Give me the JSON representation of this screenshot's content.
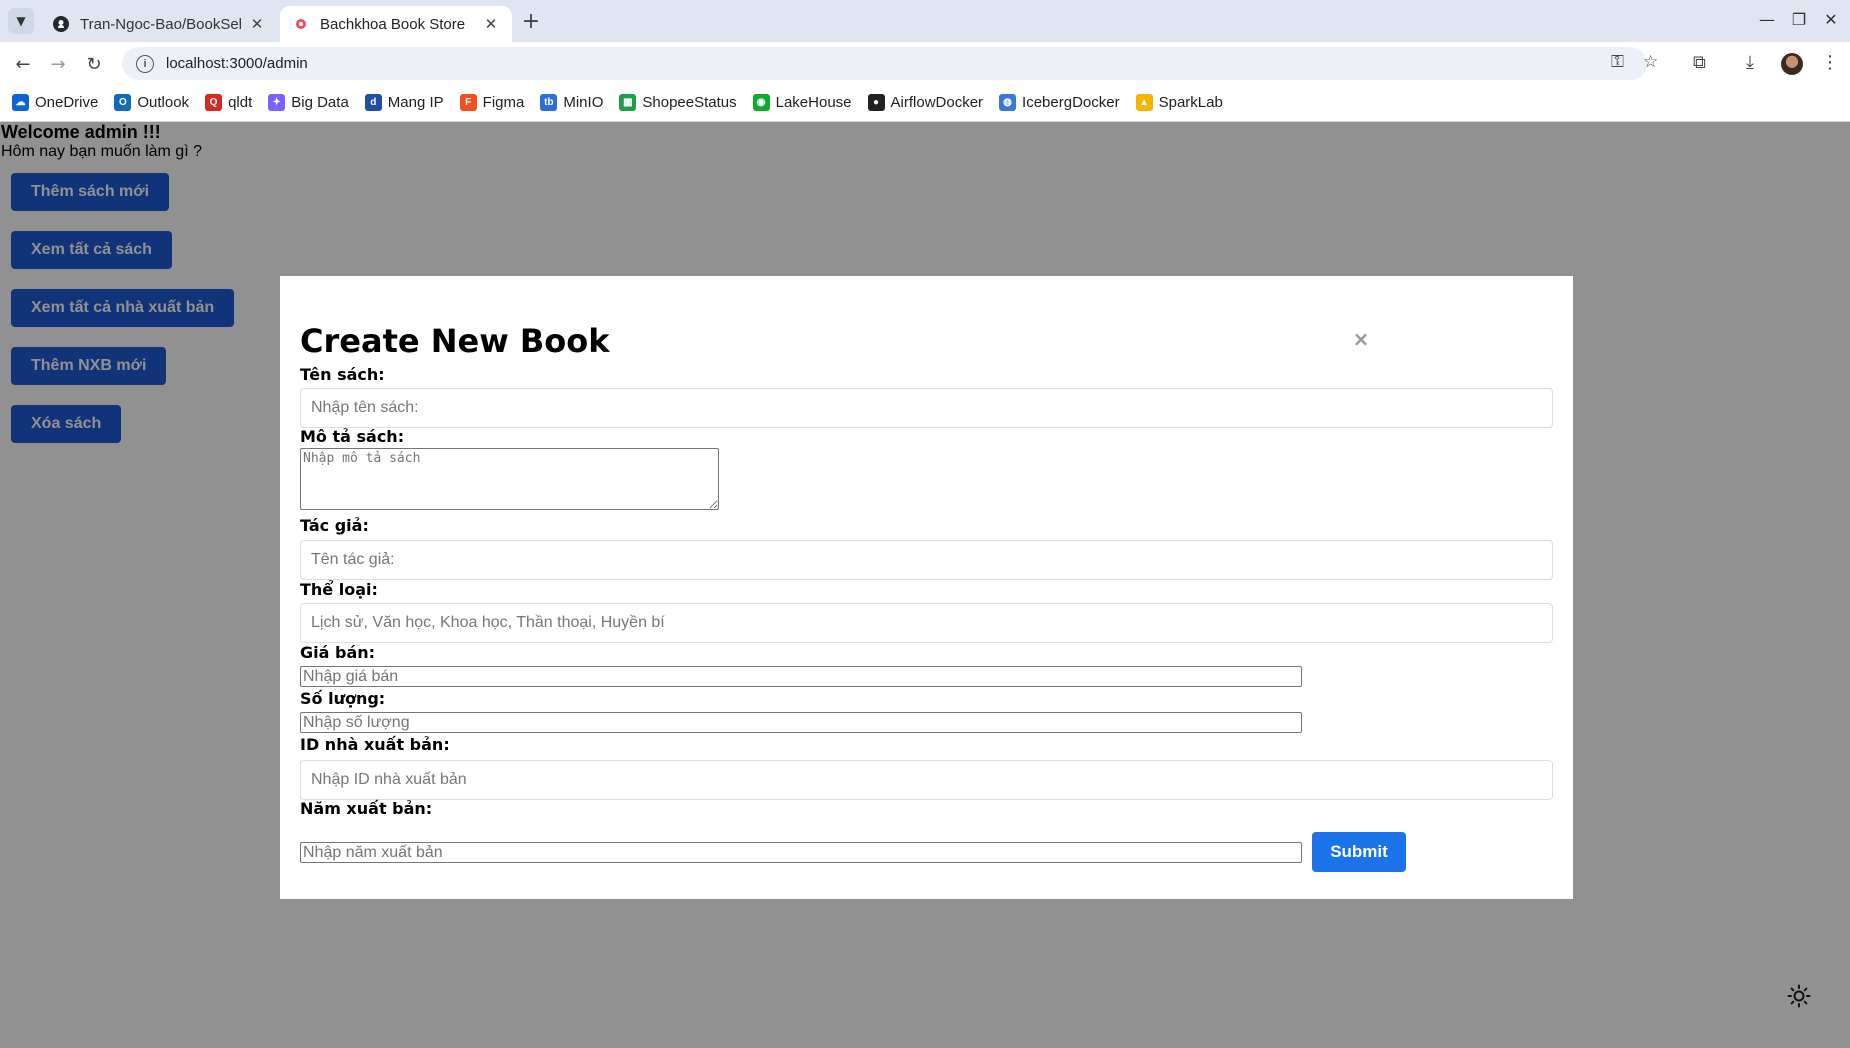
{
  "browser": {
    "tabs": [
      {
        "title": "Tran-Ngoc-Bao/BookSel",
        "icon": "github-icon",
        "active": false
      },
      {
        "title": "Bachkhoa Book Store",
        "icon": "react-icon",
        "active": true
      }
    ],
    "url": "localhost:3000/admin",
    "bookmarks": [
      {
        "label": "OneDrive",
        "icon": "onedrive-icon",
        "color": "#0a64d6"
      },
      {
        "label": "Outlook",
        "icon": "outlook-icon",
        "color": "#0f6cbd"
      },
      {
        "label": "qldt",
        "icon": "qldt-icon",
        "color": "#d8291f"
      },
      {
        "label": "Big Data",
        "icon": "bigdata-icon",
        "color": "#7b61ff"
      },
      {
        "label": "Mang IP",
        "icon": "mangip-icon",
        "color": "#1f4fa5"
      },
      {
        "label": "Figma",
        "icon": "figma-icon",
        "color": "#f24e1e"
      },
      {
        "label": "MinIO",
        "icon": "minio-icon",
        "color": "#2a6fdb"
      },
      {
        "label": "ShopeeStatus",
        "icon": "sheets-icon",
        "color": "#1e9e4a"
      },
      {
        "label": "LakeHouse",
        "icon": "lakehouse-icon",
        "color": "#11a832"
      },
      {
        "label": "AirflowDocker",
        "icon": "github-icon",
        "color": "#222222"
      },
      {
        "label": "IcebergDocker",
        "icon": "globe-icon",
        "color": "#3a78d8"
      },
      {
        "label": "SparkLab",
        "icon": "drive-icon",
        "color": "#f4b400"
      }
    ]
  },
  "sidebar": {
    "welcome": "Welcome admin !!!",
    "subtitle": "Hôm nay bạn muốn làm gì ?",
    "buttons": [
      "Thêm sách mới",
      "Xem tất cả sách",
      "Xem tất cả nhà xuất bản",
      "Thêm NXB mới",
      "Xóa sách"
    ]
  },
  "modal": {
    "title": "Create New Book",
    "close": "×",
    "fields": {
      "name": {
        "label": "Tên sách:",
        "placeholder": "Nhập tên sách:"
      },
      "description": {
        "label": "Mô tả sách:",
        "placeholder": "Nhập mô tả sách"
      },
      "author": {
        "label": "Tác giả:",
        "placeholder": "Tên tác giả:"
      },
      "genre": {
        "label": "Thể loại:",
        "placeholder": "Lịch sử, Văn học, Khoa học, Thần thoại, Huyền bí"
      },
      "price": {
        "label": "Giá bán:",
        "placeholder": "Nhập giá bán"
      },
      "quantity": {
        "label": "Số lượng:",
        "placeholder": "Nhập số lượng"
      },
      "publisher_id": {
        "label": "ID nhà xuất bản:",
        "placeholder": "Nhập ID nhà xuất bản"
      },
      "year": {
        "label": "Năm xuất bản:",
        "placeholder": "Nhập năm xuất bản"
      }
    },
    "submit": "Submit"
  },
  "colors": {
    "primary_button": "#1e5ad6",
    "submit_button": "#1a73e8",
    "overlay": "rgba(0,0,0,0.43)"
  }
}
